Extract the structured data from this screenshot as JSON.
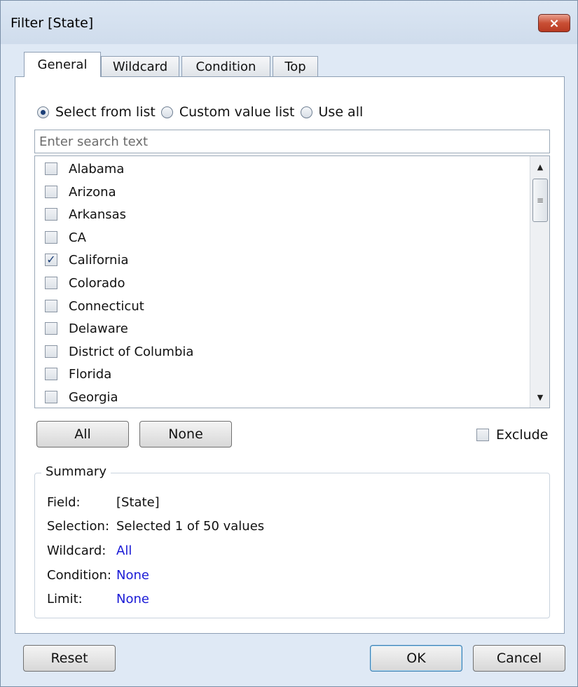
{
  "window": {
    "title": "Filter [State]",
    "close_label": "×"
  },
  "tabs": [
    {
      "label": "General",
      "active": true
    },
    {
      "label": "Wildcard",
      "active": false
    },
    {
      "label": "Condition",
      "active": false
    },
    {
      "label": "Top",
      "active": false
    }
  ],
  "mode": {
    "options": [
      "Select from list",
      "Custom value list",
      "Use all"
    ],
    "selected": "Select from list"
  },
  "search": {
    "placeholder": "Enter search text",
    "value": ""
  },
  "list": {
    "items": [
      {
        "label": "Alabama",
        "checked": false
      },
      {
        "label": "Arizona",
        "checked": false
      },
      {
        "label": "Arkansas",
        "checked": false
      },
      {
        "label": "CA",
        "checked": false
      },
      {
        "label": "California",
        "checked": true
      },
      {
        "label": "Colorado",
        "checked": false
      },
      {
        "label": "Connecticut",
        "checked": false
      },
      {
        "label": "Delaware",
        "checked": false
      },
      {
        "label": "District of Columbia",
        "checked": false
      },
      {
        "label": "Florida",
        "checked": false
      },
      {
        "label": "Georgia",
        "checked": false
      }
    ]
  },
  "buttons": {
    "all": "All",
    "none": "None",
    "exclude_label": "Exclude",
    "exclude_checked": false,
    "reset": "Reset",
    "ok": "OK",
    "cancel": "Cancel"
  },
  "summary": {
    "legend": "Summary",
    "rows": [
      {
        "key": "Field:",
        "value": "[State]",
        "color": "#111111"
      },
      {
        "key": "Selection:",
        "value": "Selected 1 of 50 values",
        "color": "#111111"
      },
      {
        "key": "Wildcard:",
        "value": "All",
        "color": "#1a1ad6"
      },
      {
        "key": "Condition:",
        "value": "None",
        "color": "#1a1ad6"
      },
      {
        "key": "Limit:",
        "value": "None",
        "color": "#1a1ad6"
      }
    ]
  },
  "icons": {
    "close": "close-icon",
    "scroll_up": "chevron-up-icon",
    "scroll_down": "chevron-down-icon",
    "checkmark": "checkmark-icon"
  }
}
